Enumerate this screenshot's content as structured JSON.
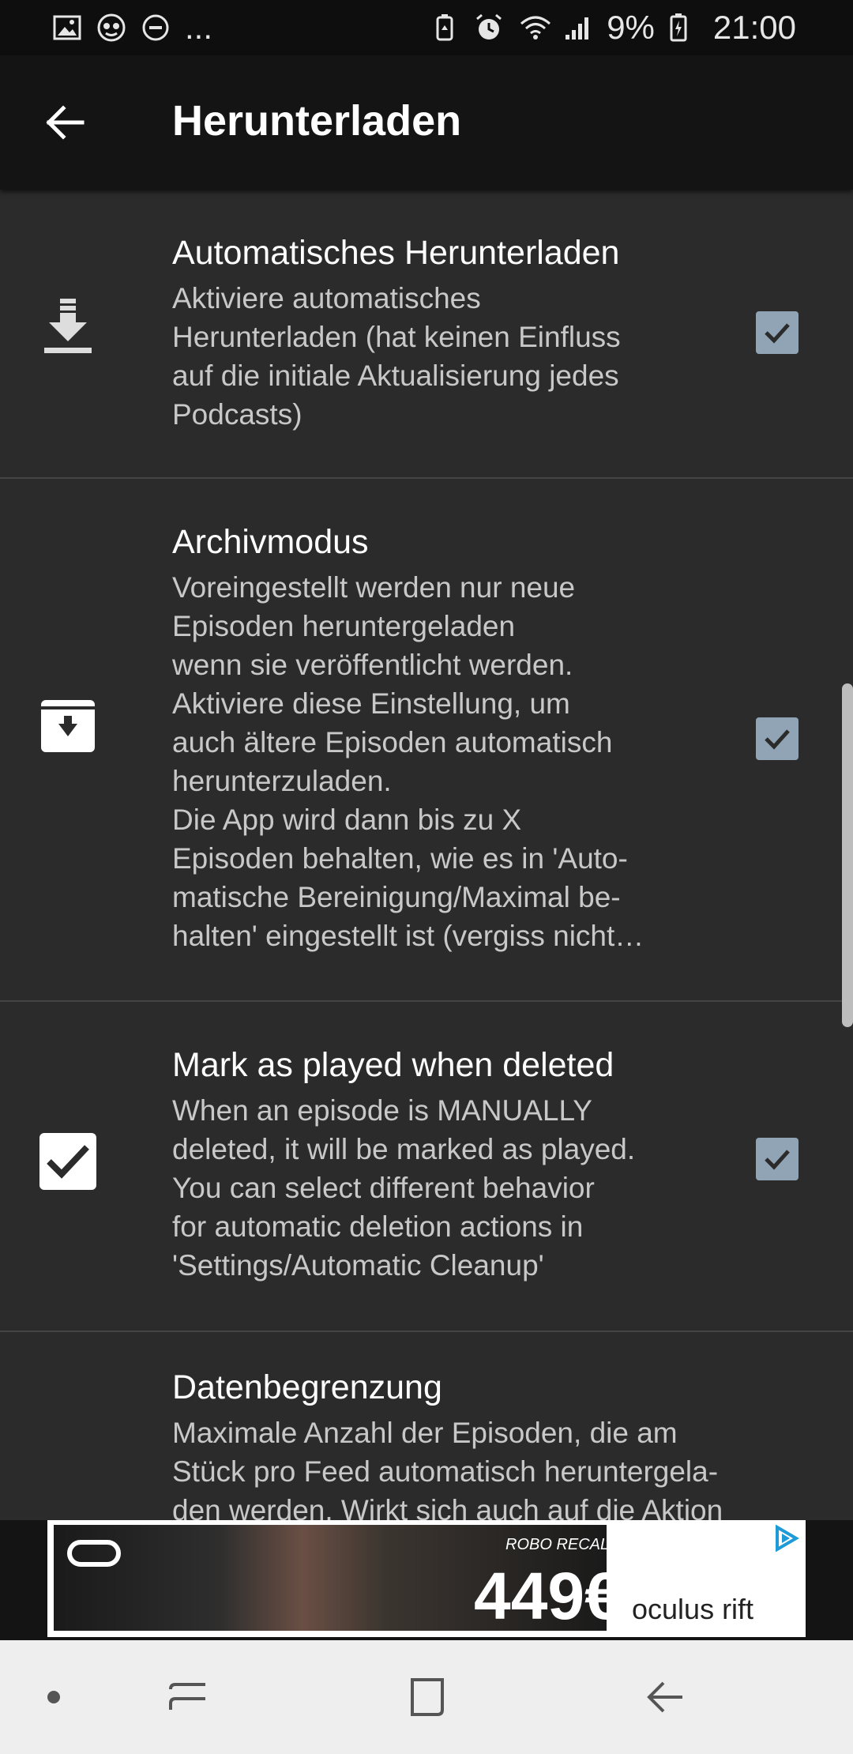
{
  "status_bar": {
    "left_icons": [
      "image-icon",
      "podcast-icon",
      "do-not-disturb-icon"
    ],
    "ellipsis": "...",
    "right_icons": [
      "battery-saver-icon",
      "alarm-icon",
      "wifi-icon",
      "signal-icon"
    ],
    "battery_text": "9%",
    "time": "21:00"
  },
  "appbar": {
    "title": "Herunterladen"
  },
  "preferences": [
    {
      "icon": "download-icon",
      "title": "Automatisches Herunterladen",
      "summary": "Aktiviere automatisches\nHerunterladen (hat keinen Einfluss\nauf die initiale Aktualisierung jedes\nPodcasts)",
      "checked": true
    },
    {
      "icon": "archive-icon",
      "title": "Archivmodus",
      "summary": "Voreingestellt werden nur neue\nEpisoden heruntergeladen\nwenn sie veröffentlicht werden.\nAktiviere diese Einstellung, um\nauch ältere Episoden automatisch\nherunterzuladen.\nDie App wird dann bis zu X\nEpisoden behalten, wie es in 'Auto-\nmatische Bereinigung/Maximal be-\nhalten' eingestellt ist (vergiss nicht…",
      "checked": true
    },
    {
      "icon": "checkbox-icon",
      "title": "Mark as played when deleted",
      "summary": "When an episode is MANUALLY\ndeleted, it will be marked as played.\nYou can select different behavior\nfor automatic deletion actions in\n'Settings/Automatic Cleanup'",
      "checked": true
    },
    {
      "icon": "data-limit-icon",
      "title": "Datenbegrenzung",
      "summary": "Maximale Anzahl der Episoden, die am\nStück pro Feed automatisch heruntergela-\nden werden. Wirkt sich auch auf die Aktion",
      "checked": null
    }
  ],
  "ad": {
    "small_text": "ROBO RECALL",
    "price": "449€",
    "brand": "oculus rift"
  },
  "navbar": {
    "buttons": [
      "dot-icon",
      "recent-apps-icon",
      "home-icon",
      "back-icon"
    ]
  }
}
